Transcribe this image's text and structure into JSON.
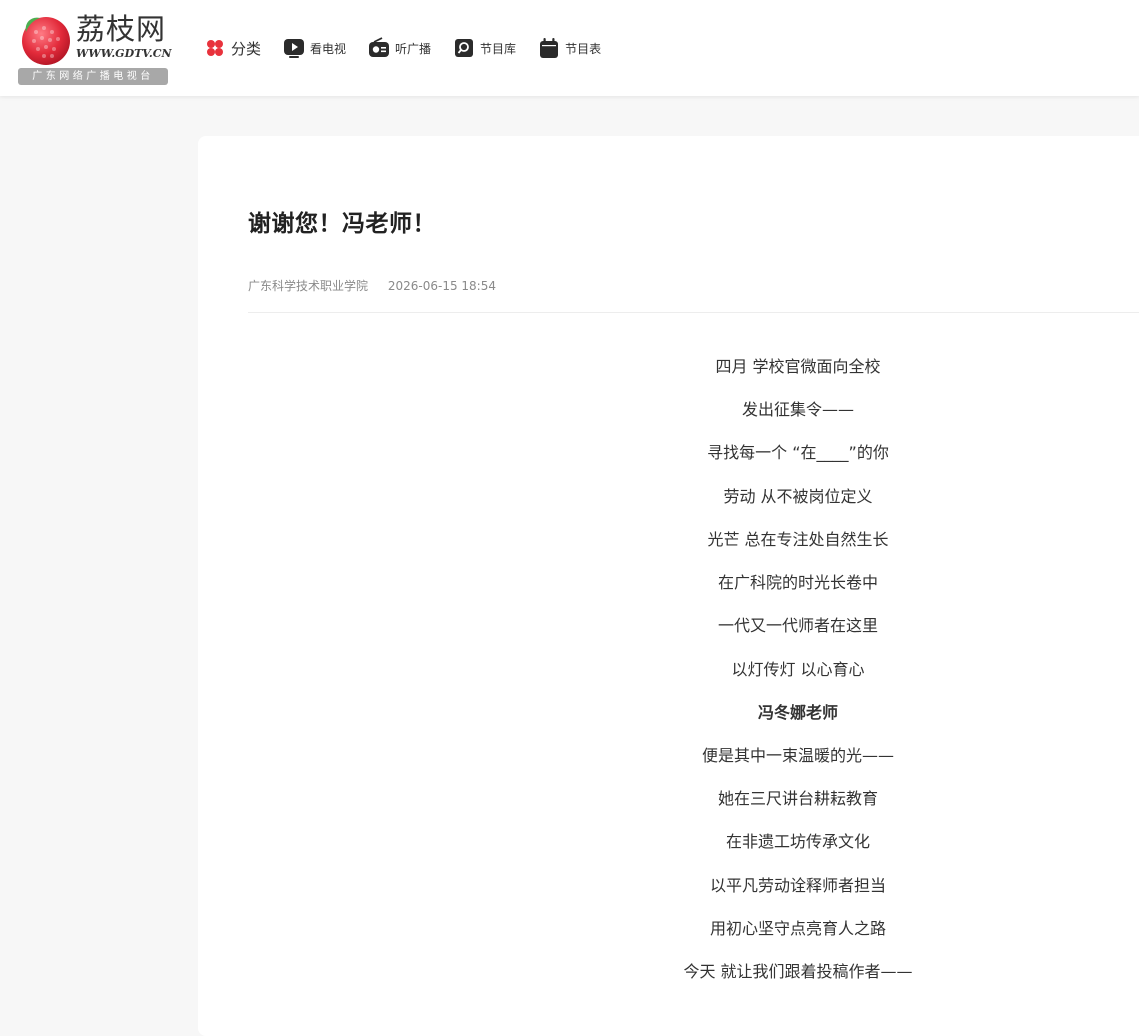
{
  "site": {
    "logo_name": "荔枝网",
    "logo_url": "WWW.GDTV.CN",
    "logo_tagline": "广东网络广播电视台"
  },
  "nav": {
    "items": [
      {
        "label": "分类",
        "icon": "category-icon"
      },
      {
        "label": "看电视",
        "icon": "tv-play-icon"
      },
      {
        "label": "听广播",
        "icon": "radio-icon"
      },
      {
        "label": "节目库",
        "icon": "library-search-icon"
      },
      {
        "label": "节目表",
        "icon": "calendar-icon"
      }
    ]
  },
  "article": {
    "title": "谢谢您！冯老师！",
    "source": "广东科学技术职业学院",
    "date": "2026-06-15 18:54",
    "lines": [
      "四月 学校官微面向全校",
      "发出征集令——",
      "寻找每一个 “在____”的你",
      "劳动 从不被岗位定义",
      "光芒 总在专注处自然生长",
      "在广科院的时光长卷中",
      "一代又一代师者在这里",
      "以灯传灯 以心育心",
      "冯冬娜老师",
      "便是其中一束温暖的光——",
      "她在三尺讲台耕耘教育",
      "在非遗工坊传承文化",
      "以平凡劳动诠释师者担当",
      "用初心坚守点亮育人之路",
      "今天 就让我们跟着投稿作者——"
    ]
  },
  "colors": {
    "brand_red": "#e8323c",
    "icon_dark": "#2b2b2b",
    "page_bg": "#f7f7f7"
  }
}
